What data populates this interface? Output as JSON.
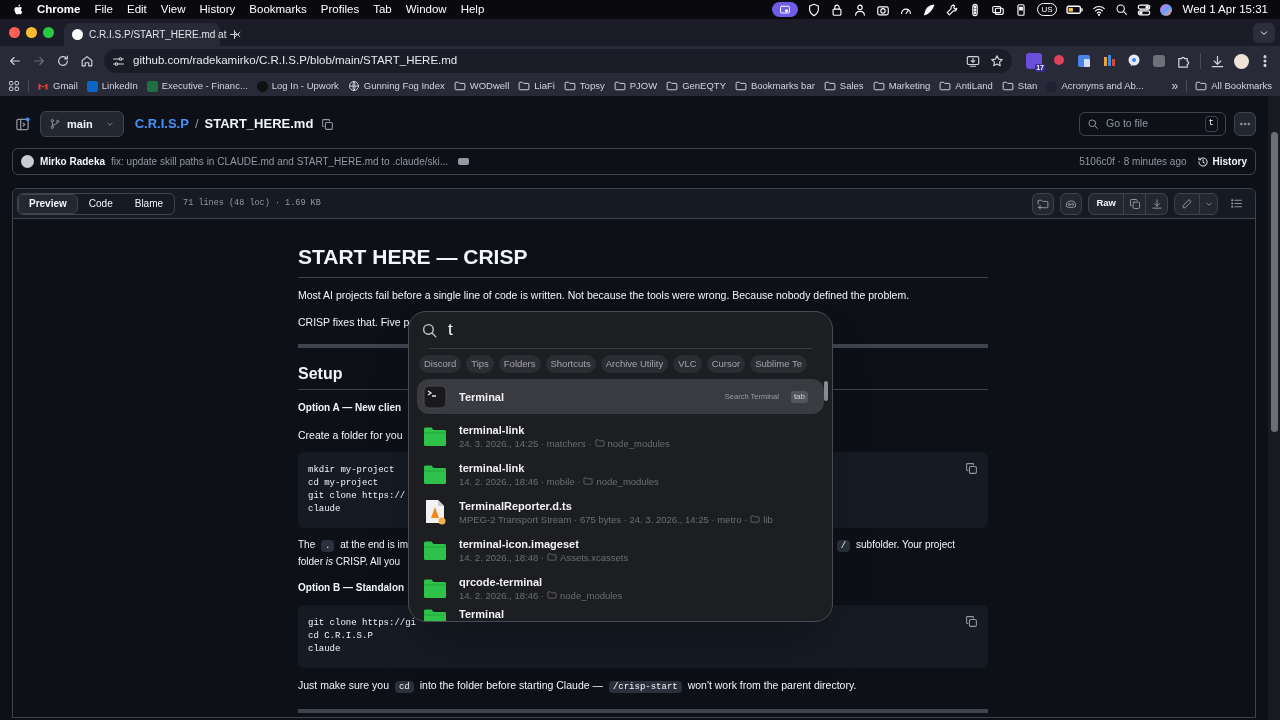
{
  "menu_bar": {
    "app": "Chrome",
    "items": [
      "File",
      "Edit",
      "View",
      "History",
      "Bookmarks",
      "Profiles",
      "Tab",
      "Window",
      "Help"
    ],
    "keyboard_layout": "US",
    "clock": "Wed 1 Apr  15:31"
  },
  "browser": {
    "tab_title": "C.R.I.S.P/START_HERE.md at",
    "url": "github.com/radekamirko/C.R.I.S.P/blob/main/START_HERE.md",
    "extension_badge": "17",
    "bookmarks": [
      {
        "label": "Gmail",
        "kind": "mail"
      },
      {
        "label": "LinkedIn",
        "kind": "tile",
        "color": "#0a66c2"
      },
      {
        "label": "Executive - Financ...",
        "kind": "tile",
        "color": "#1d7044"
      },
      {
        "label": "Log In - Upwork",
        "kind": "circle",
        "color": "#111111"
      },
      {
        "label": "Gunning Fog Index",
        "kind": "globe"
      },
      {
        "label": "WODwell",
        "kind": "folder"
      },
      {
        "label": "LiaFi",
        "kind": "folder"
      },
      {
        "label": "Topsy",
        "kind": "folder"
      },
      {
        "label": "PJOW",
        "kind": "folder"
      },
      {
        "label": "GenEQTY",
        "kind": "folder"
      },
      {
        "label": "Bookmarks bar",
        "kind": "folder"
      },
      {
        "label": "Sales",
        "kind": "folder"
      },
      {
        "label": "Marketing",
        "kind": "folder"
      },
      {
        "label": "AntiLand",
        "kind": "folder"
      },
      {
        "label": "Stan",
        "kind": "folder"
      },
      {
        "label": "Acronyms and Ab...",
        "kind": "circle",
        "color": "#1e2233"
      }
    ],
    "overflow": "»",
    "all_bookmarks": "All Bookmarks"
  },
  "repo_header": {
    "branch": "main",
    "repo": "C.R.I.S.P",
    "separator": "/",
    "file": "START_HERE.md",
    "go_to_file": {
      "placeholder": "Go to file",
      "shortcut": "t"
    }
  },
  "commit": {
    "author": "Mirko Radeka",
    "message": "fix: update skill paths in CLAUDE.md and START_HERE.md to .claude/ski...",
    "sha_time": "5106c0f · 8 minutes ago",
    "history": "History"
  },
  "file_header": {
    "tabs": [
      {
        "label": "Preview",
        "selected": true
      },
      {
        "label": "Code",
        "selected": false
      },
      {
        "label": "Blame",
        "selected": false
      }
    ],
    "info": "71 lines (48 loc) · 1.69 KB",
    "raw": "Raw"
  },
  "article": [
    {
      "kind": "h1",
      "text": "START HERE — CRISP"
    },
    {
      "kind": "p",
      "segments": [
        {
          "text": "Most AI projects fail before a single line of code is written. Not because the tools were wrong. Because nobody defined the problem.",
          "code": false
        }
      ]
    },
    {
      "kind": "p",
      "segments": [
        {
          "text": "CRISP fixes that. Five p",
          "code": false
        }
      ]
    },
    {
      "kind": "hr"
    },
    {
      "kind": "h2",
      "text": "Setup"
    },
    {
      "kind": "bold",
      "text": "Option A — New clien"
    },
    {
      "kind": "p",
      "segments": [
        {
          "text": "Create a folder for you",
          "code": false
        }
      ]
    },
    {
      "kind": "code",
      "lines": [
        "mkdir my-project",
        "cd my-project",
        "git clone https://",
        "claude"
      ]
    },
    {
      "kind": "split",
      "lines": [
        {
          "left": [
            {
              "text": "The",
              "code": false
            },
            {
              "text": ".",
              "code": true
            },
            {
              "text": "at the end is im",
              "code": false
            }
          ],
          "right": [
            {
              "text": "/",
              "code": true
            },
            {
              "text": "subfolder. Your project",
              "code": false
            }
          ]
        },
        {
          "left": [
            {
              "text": "folder *is* CRISP. All you",
              "code": false
            }
          ]
        }
      ]
    },
    {
      "kind": "bold",
      "text": "Option B — Standalon"
    },
    {
      "kind": "code",
      "lines": [
        "git clone https://gi",
        "cd C.R.I.S.P",
        "claude"
      ]
    },
    {
      "kind": "p",
      "segments": [
        {
          "text": "Just make sure you",
          "code": false
        },
        {
          "text": "cd",
          "code": true
        },
        {
          "text": "into the folder before starting Claude —",
          "code": false
        },
        {
          "text": "/crisp-start",
          "code": true
        },
        {
          "text": "won't work from the parent directory.",
          "code": false
        }
      ]
    },
    {
      "kind": "hr"
    }
  ],
  "spotlight": {
    "query": "t",
    "chips": [
      "Discord",
      "Tips",
      "Folders",
      "Shortcuts",
      "Archive Utility",
      "VLC",
      "Cursor",
      "Sublime Te"
    ],
    "results": [
      {
        "kind": "app",
        "title": "Terminal",
        "selected": true,
        "hint": "Search Terminal",
        "key": "tab"
      },
      {
        "kind": "folder",
        "title": "terminal-link",
        "meta": "24. 3. 2026., 14:25 · matchers ·",
        "location": "node_modules",
        "selected": false
      },
      {
        "kind": "folder",
        "title": "terminal-link",
        "meta": "14. 2. 2026., 18:46 · mobile ·",
        "location": "node_modules",
        "selected": false
      },
      {
        "kind": "file",
        "title": "TerminalReporter.d.ts",
        "meta": "MPEG-2 Transport Stream · 675 bytes · 24. 3. 2026., 14:25 · metro ·",
        "location": "lib",
        "selected": false
      },
      {
        "kind": "folder",
        "title": "terminal-icon.imageset",
        "meta": "14. 2. 2026., 18:48 ·",
        "location": "Assets.xcassets",
        "selected": false
      },
      {
        "kind": "folder",
        "title": "qrcode-terminal",
        "meta": "14. 2. 2026., 18:46 ·",
        "location": "node_modules",
        "selected": false
      },
      {
        "kind": "folder",
        "title": "Terminal",
        "selected": false
      }
    ]
  }
}
